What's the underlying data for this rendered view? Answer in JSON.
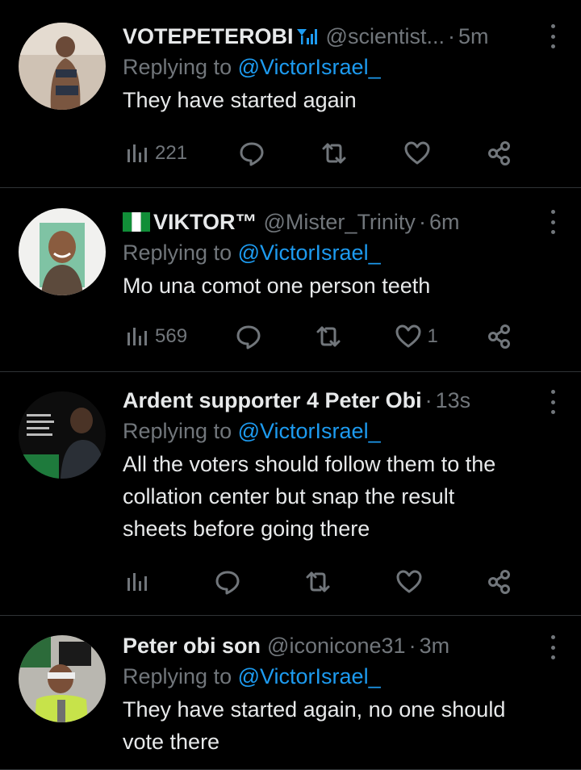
{
  "tweets": [
    {
      "name": "VOTEPETEROBI",
      "handle": "@scientist...",
      "time": "5m",
      "replying_prefix": "Replying to",
      "replying_to": "@VictorIsrael_",
      "text_lines": [
        "They have started again"
      ],
      "views": "221",
      "likes": ""
    },
    {
      "name": "VIKTOR™",
      "handle": "@Mister_Trinity",
      "time": "6m",
      "replying_prefix": "Replying to",
      "replying_to": "@VictorIsrael_",
      "text_lines": [
        "Mo una comot one person teeth"
      ],
      "views": "569",
      "likes": "1"
    },
    {
      "name": "Ardent supporter 4 Peter Obi",
      "handle": "",
      "time": "13s",
      "replying_prefix": "Replying to",
      "replying_to": "@VictorIsrael_",
      "text_lines": [
        "All the voters should follow them to the",
        "collation center but snap the result",
        "sheets before going there"
      ],
      "views": "",
      "likes": ""
    },
    {
      "name": "Peter obi son",
      "handle": "@iconicone31",
      "time": "3m",
      "replying_prefix": "Replying to",
      "replying_to": "@VictorIsrael_",
      "text_lines": [
        "They have started again, no one should",
        "vote there"
      ],
      "views": "",
      "likes": ""
    }
  ],
  "separator": "·",
  "colors": {
    "background": "#000000",
    "primary_text": "#e7e9ea",
    "secondary_text": "#71767b",
    "link": "#1d9bf0",
    "divider": "#2f3336"
  },
  "icons": [
    "views-icon",
    "reply-icon",
    "retweet-icon",
    "like-icon",
    "share-icon",
    "more-icon",
    "nigeria-flag-icon",
    "signal-bars-icon"
  ]
}
